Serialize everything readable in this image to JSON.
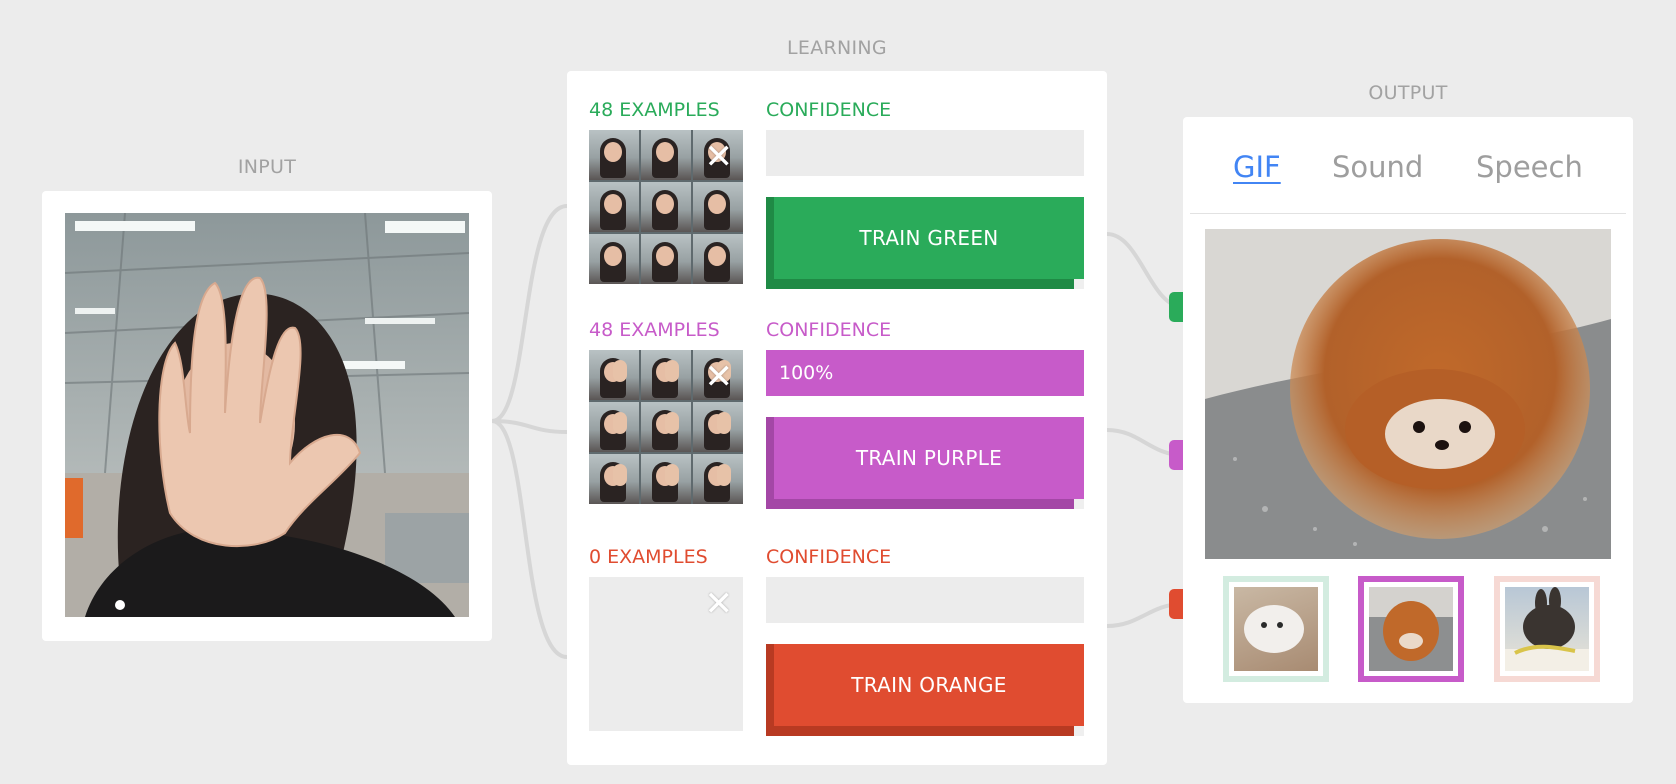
{
  "sections": {
    "input": "INPUT",
    "learning": "LEARNING",
    "output": "OUTPUT"
  },
  "colors": {
    "background": "#ececec",
    "green": "#2aab5a",
    "green_dark": "#1f8a45",
    "purple": "#c75bc9",
    "purple_dark": "#a447a6",
    "orange": "#e04c30",
    "orange_dark": "#b83a22",
    "tab_active": "#4285f4",
    "label_gray": "#a2a2a2"
  },
  "input": {
    "camera_icon": "webcam-feed"
  },
  "learning": {
    "classes": [
      {
        "id": "green",
        "examples_label": "48 EXAMPLES",
        "confidence_label": "CONFIDENCE",
        "confidence_value": "",
        "confidence_fraction": 0,
        "train_label": "TRAIN GREEN",
        "clear_icon": "close-icon",
        "color": "#2aab5a",
        "dark": "#1f8a45",
        "has_examples": true
      },
      {
        "id": "purple",
        "examples_label": "48 EXAMPLES",
        "confidence_label": "CONFIDENCE",
        "confidence_value": "100%",
        "confidence_fraction": 1.0,
        "train_label": "TRAIN PURPLE",
        "clear_icon": "close-icon",
        "color": "#c75bc9",
        "dark": "#a447a6",
        "has_examples": true
      },
      {
        "id": "orange",
        "examples_label": "0 EXAMPLES",
        "confidence_label": "CONFIDENCE",
        "confidence_value": "",
        "confidence_fraction": 0,
        "train_label": "TRAIN ORANGE",
        "clear_icon": "close-icon",
        "color": "#e04c30",
        "dark": "#b83a22",
        "has_examples": false
      }
    ]
  },
  "output": {
    "tabs": [
      {
        "label": "GIF",
        "active": true
      },
      {
        "label": "Sound",
        "active": false
      },
      {
        "label": "Speech",
        "active": false
      }
    ],
    "selected_gif": "pomeranian-gif",
    "thumbnails": [
      {
        "name": "cat-gif",
        "border_color": "#d3ece0",
        "selected": false
      },
      {
        "name": "pomeranian-gif",
        "border_color": "#c75bc9",
        "selected": true
      },
      {
        "name": "bunny-gif",
        "border_color": "#f6d9d4",
        "selected": false
      }
    ]
  }
}
